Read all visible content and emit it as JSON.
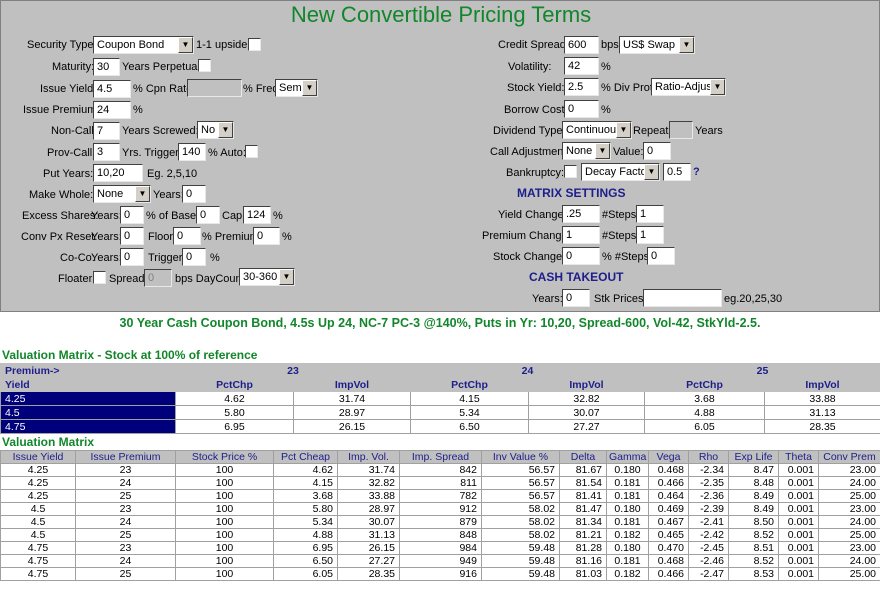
{
  "title": "New Convertible Pricing Terms",
  "left": {
    "security_type_label": "Security Type:",
    "security_type_value": "Coupon Bond",
    "one_to_one_upside_label": "1-1 upside:",
    "maturity_label": "Maturity:",
    "maturity_value": "30",
    "years_perpetual_label": "Years Perpetual:",
    "issue_yield_label": "Issue Yield:",
    "issue_yield_value": "4.5",
    "cpn_rate_label": "% Cpn Rate",
    "freq_label": "% Freq:",
    "freq_value": "Semi",
    "issue_premium_label": "Issue Premium:",
    "issue_premium_value": "24",
    "pct": "%",
    "non_call_label": "Non-Call:",
    "non_call_value": "7",
    "years_screwed_label": "Years Screwed:",
    "years_screwed_value": "No",
    "prov_call_label": "Prov-Call:",
    "prov_call_value": "3",
    "yrs_trigger_label": "Yrs.  Trigger:",
    "trigger_value": "140",
    "auto_label": "% Auto:",
    "put_years_label": "Put Years:",
    "put_years_value": "10,20",
    "put_years_hint": "Eg. 2,5,10",
    "make_whole_label": "Make Whole:",
    "make_whole_value": "None",
    "years_label": "Years:",
    "make_whole_years_value": "0",
    "excess_shares_label": "Excess Shares:",
    "excess_years_value": "0",
    "of_base_label": "% of Base:",
    "of_base_value": "0",
    "cap_label": "Cap:",
    "cap_value": "124",
    "conv_px_reset_label": "Conv Px Reset:",
    "reset_years_value": "0",
    "floor_label": "Floor:",
    "floor_value": "0",
    "premium_label": "% Premium:",
    "reset_premium_value": "0",
    "coco_label": "Co-Co:",
    "coco_years_value": "0",
    "trigger_label": "Trigger:",
    "coco_trigger_value": "0",
    "floater_label": "Floater:",
    "spread_label": "Spread:",
    "spread_value": "0",
    "bps_daycount_label": "bps DayCount:",
    "daycount_value": "30-360"
  },
  "right": {
    "credit_spread_label": "Credit Spread:",
    "credit_spread_value": "600",
    "bps_label": "bps",
    "curve_value": "US$ Swap",
    "volatility_label": "Volatility:",
    "volatility_value": "42",
    "stock_yield_label": "Stock Yield:",
    "stock_yield_value": "2.5",
    "div_prot_label": "% Div Prot:",
    "div_prot_value": "Ratio-Adjust",
    "borrow_cost_label": "Borrow Cost:",
    "borrow_cost_value": "0",
    "dividend_type_label": "Dividend Type:",
    "dividend_type_value": "Continuous",
    "repeat_label": "Repeat:",
    "years_label": "Years",
    "call_adjustment_label": "Call Adjustment:",
    "call_adjustment_value": "None",
    "value_label": "Value:",
    "call_value": "0",
    "bankruptcy_label": "Bankruptcy:",
    "decay_value": "Decay Factor",
    "decay_factor_value": "0.5",
    "help": "?",
    "matrix_settings_heading": "MATRIX SETTINGS",
    "yield_change_label": "Yield Change:",
    "yield_change_value": ".25",
    "steps_label": "#Steps:",
    "yield_steps_value": "1",
    "premium_change_label": "Premium Change:",
    "premium_change_value": "1",
    "premium_steps_value": "1",
    "stock_change_label": "Stock Change:",
    "stock_change_value": "0",
    "pct_steps_label": "% #Steps:",
    "stock_steps_value": "0",
    "cash_takeout_heading": "CASH TAKEOUT",
    "takeout_years_label": "Years:",
    "takeout_years_value": "0",
    "stk_prices_label": "Stk Prices:",
    "stk_prices_hint": "eg.20,25,30"
  },
  "summary": "30 Year Cash Coupon Bond, 4.5s Up 24, NC-7 PC-3 @140%, Puts in Yr: 10,20, Spread-600, Vol-42, StkYld-2.5.",
  "matrix1": {
    "title": "Valuation Matrix - Stock at 100% of reference",
    "premium_label": "Premium->",
    "yield_label": "Yield",
    "premiums": [
      "23",
      "24",
      "25"
    ],
    "col_pctchp": "PctChp",
    "col_impvol": "ImpVol",
    "rows": [
      {
        "yield": "4.25",
        "values": [
          "4.62",
          "31.74",
          "4.15",
          "32.82",
          "3.68",
          "33.88"
        ]
      },
      {
        "yield": "4.5",
        "values": [
          "5.80",
          "28.97",
          "5.34",
          "30.07",
          "4.88",
          "31.13"
        ]
      },
      {
        "yield": "4.75",
        "values": [
          "6.95",
          "26.15",
          "6.50",
          "27.27",
          "6.05",
          "28.35"
        ]
      }
    ]
  },
  "matrix2": {
    "title": "Valuation Matrix",
    "headers": [
      "Issue Yield",
      "Issue Premium",
      "Stock Price %",
      "Pct Cheap",
      "Imp. Vol.",
      "Imp. Spread",
      "Inv Value %",
      "Delta",
      "Gamma",
      "Vega",
      "Rho",
      "Exp Life",
      "Theta",
      "Conv Prem"
    ],
    "rows": [
      [
        "4.25",
        "23",
        "100",
        "4.62",
        "31.74",
        "842",
        "56.57",
        "81.67",
        "0.180",
        "0.468",
        "-2.34",
        "8.47",
        "0.001",
        "23.00"
      ],
      [
        "4.25",
        "24",
        "100",
        "4.15",
        "32.82",
        "811",
        "56.57",
        "81.54",
        "0.181",
        "0.466",
        "-2.35",
        "8.48",
        "0.001",
        "24.00"
      ],
      [
        "4.25",
        "25",
        "100",
        "3.68",
        "33.88",
        "782",
        "56.57",
        "81.41",
        "0.181",
        "0.464",
        "-2.36",
        "8.49",
        "0.001",
        "25.00"
      ],
      [
        "4.5",
        "23",
        "100",
        "5.80",
        "28.97",
        "912",
        "58.02",
        "81.47",
        "0.180",
        "0.469",
        "-2.39",
        "8.49",
        "0.001",
        "23.00"
      ],
      [
        "4.5",
        "24",
        "100",
        "5.34",
        "30.07",
        "879",
        "58.02",
        "81.34",
        "0.181",
        "0.467",
        "-2.41",
        "8.50",
        "0.001",
        "24.00"
      ],
      [
        "4.5",
        "25",
        "100",
        "4.88",
        "31.13",
        "848",
        "58.02",
        "81.21",
        "0.182",
        "0.465",
        "-2.42",
        "8.52",
        "0.001",
        "25.00"
      ],
      [
        "4.75",
        "23",
        "100",
        "6.95",
        "26.15",
        "984",
        "59.48",
        "81.28",
        "0.180",
        "0.470",
        "-2.45",
        "8.51",
        "0.001",
        "23.00"
      ],
      [
        "4.75",
        "24",
        "100",
        "6.50",
        "27.27",
        "949",
        "59.48",
        "81.16",
        "0.181",
        "0.468",
        "-2.46",
        "8.52",
        "0.001",
        "24.00"
      ],
      [
        "4.75",
        "25",
        "100",
        "6.05",
        "28.35",
        "916",
        "59.48",
        "81.03",
        "0.182",
        "0.466",
        "-2.47",
        "8.53",
        "0.001",
        "25.00"
      ]
    ]
  },
  "icons": {
    "dropdown": "chevron-down-icon"
  },
  "colors": {
    "title_green": "#11862a",
    "heading_blue": "#1d1d8c",
    "form_gray": "#c0c0c0",
    "yield_cell_navy": "#00007a"
  }
}
